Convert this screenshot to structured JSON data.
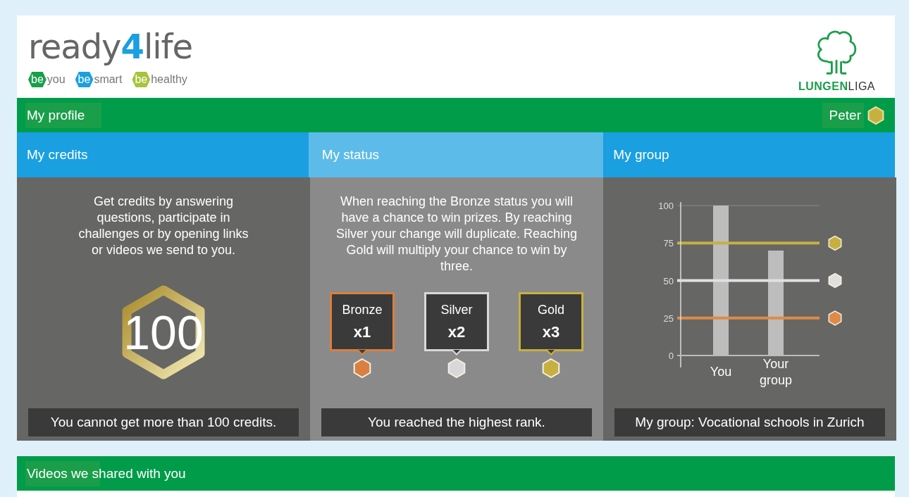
{
  "header": {
    "logo": [
      "ready",
      "4",
      "life"
    ],
    "taglines": [
      {
        "badge": "be",
        "word": "you",
        "color": "#1a9e4a"
      },
      {
        "badge": "be",
        "word": "smart",
        "color": "#1a9fe0"
      },
      {
        "badge": "be",
        "word": "healthy",
        "color": "#a8c43c"
      }
    ],
    "partner": [
      "LUNGEN",
      "LIGA"
    ]
  },
  "profile_bar": {
    "title": "My profile",
    "user": "Peter"
  },
  "tabs": [
    {
      "label": "My credits",
      "selected": false
    },
    {
      "label": "My status",
      "selected": true
    },
    {
      "label": "My group",
      "selected": false
    }
  ],
  "credits": {
    "text": "Get credits by answering questions, participate in challenges or by opening links or videos we send to you.",
    "value": "100",
    "note": "You cannot get more than 100 credits."
  },
  "status": {
    "text": "When reaching the Bronze status you will have a chance to win prizes. By reaching Silver your change will duplicate. Reaching Gold will multiply your chance to win by three.",
    "tiers": [
      {
        "name": "Bronze",
        "multiplier": "x1",
        "color": "#d98040"
      },
      {
        "name": "Silver",
        "multiplier": "x2",
        "color": "#d8d8d8"
      },
      {
        "name": "Gold",
        "multiplier": "x3",
        "color": "#c8b040"
      }
    ],
    "note": "You reached the highest rank."
  },
  "group": {
    "chart_data": {
      "type": "bar",
      "categories": [
        "You",
        "Your group"
      ],
      "values": [
        100,
        70
      ],
      "ylim": [
        0,
        100
      ],
      "yticks": [
        0,
        25,
        50,
        75,
        100
      ],
      "ref_lines": [
        {
          "axis": "y",
          "value": 75,
          "color": "#c8b040"
        },
        {
          "axis": "y",
          "value": 50,
          "color": "#e0e0e0"
        },
        {
          "axis": "y",
          "value": 25,
          "color": "#e08a48"
        }
      ]
    },
    "note": "My group: Vocational schools in Zurich"
  },
  "videos_bar": {
    "title": "Videos we shared with you"
  }
}
